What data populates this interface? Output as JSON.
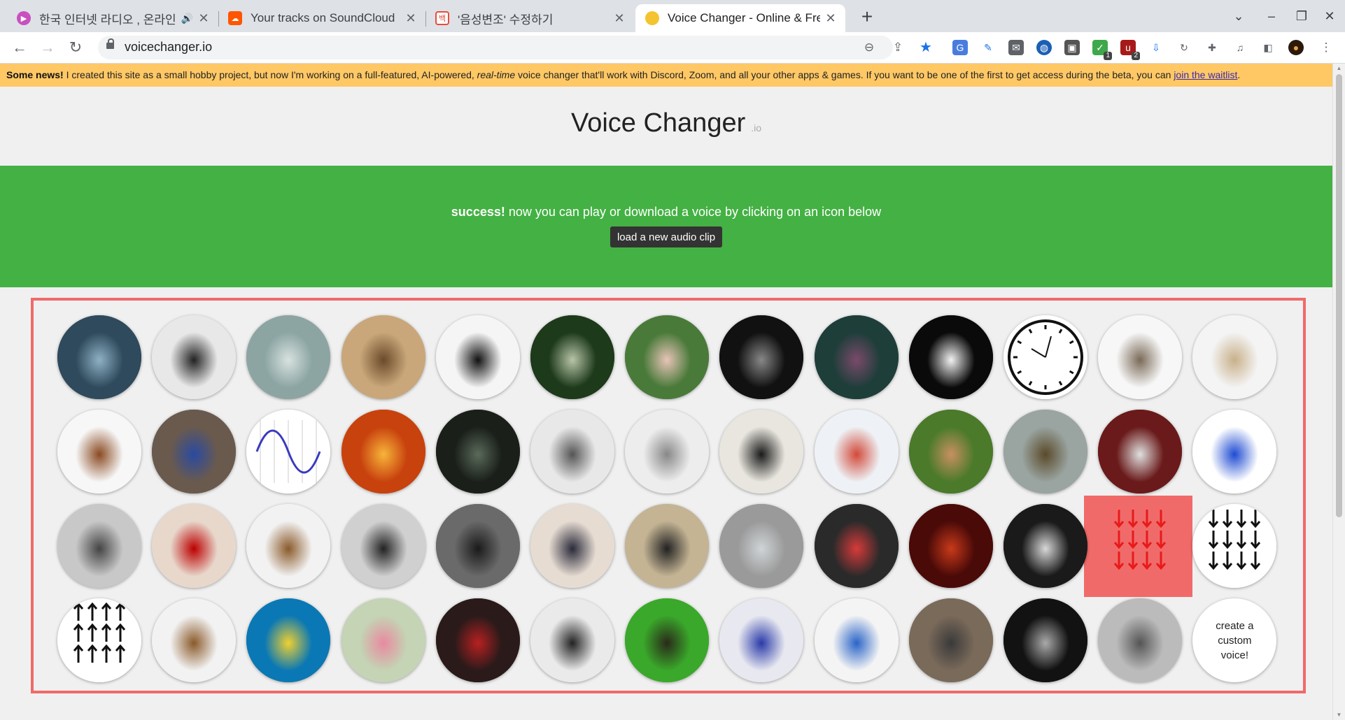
{
  "browser": {
    "tabs": [
      {
        "title": "한국 인터넷 라디오 , 온라인 라디오",
        "favicon": "#c850c0",
        "audio": true
      },
      {
        "title": "Your tracks on SoundCloud",
        "favicon": "#ff5500"
      },
      {
        "title": "'음성변조' 수정하기",
        "favicon": "#e74c3c",
        "favicon_text": "백"
      },
      {
        "title": "Voice Changer - Online & Free",
        "favicon": "#f4c430"
      }
    ],
    "url": "voicechanger.io",
    "extension_badges": [
      "1",
      "2"
    ]
  },
  "page": {
    "news_bold": "Some news!",
    "news_text_1": " I created this site as a small hobby project, but now I'm working on a full-featured, AI-powered, ",
    "news_italic": "real-time",
    "news_text_2": " voice changer that'll work with Discord, Zoom, and all your other apps & games. If you want to be one of the first to get access during the beta, you can ",
    "news_link": "join the waitlist",
    "news_end": ".",
    "title": "Voice Changer",
    "title_suffix": ".io",
    "success_bold": "success!",
    "success_text": " now you can play or download a voice by clicking on an icon below",
    "load_button": "load a new audio clip",
    "custom_voice": "create a custom voice!"
  },
  "voices": [
    {
      "icon": "cave-monster-icon",
      "bg": "#2e4a5c",
      "fg": "#8fb0c4"
    },
    {
      "icon": "old-radio-tower-icon",
      "bg": "#e8e8e8",
      "fg": "#222"
    },
    {
      "icon": "ghost-hand-icon",
      "bg": "#8ca5a3",
      "fg": "#d8e2e0"
    },
    {
      "icon": "cathedral-icon",
      "bg": "#c9a77a",
      "fg": "#6a4a2a"
    },
    {
      "icon": "rotary-telephone-icon",
      "bg": "#f5f5f5",
      "fg": "#111"
    },
    {
      "icon": "alien-icon",
      "bg": "#1d3a1a",
      "fg": "#b8c4a8"
    },
    {
      "icon": "melting-clock-icon",
      "bg": "#4a7a3a",
      "fg": "#e8c4b8"
    },
    {
      "icon": "grey-alien-icon",
      "bg": "#111",
      "fg": "#888"
    },
    {
      "icon": "armored-robot-icon",
      "bg": "#1e3e3a",
      "fg": "#7a4a6a"
    },
    {
      "icon": "anonymous-mask-icon",
      "bg": "#0a0a0a",
      "fg": "#f2f2f2"
    },
    {
      "icon": "reversed-clock-icon",
      "bg": "#ffffff",
      "fg": "#111"
    },
    {
      "icon": "transistor-radio-icon",
      "bg": "#f7f7f7",
      "fg": "#7a6a58"
    },
    {
      "icon": "cymbal-icon",
      "bg": "#f4f4f4",
      "fg": "#c8b08a"
    },
    {
      "icon": "dalek-icon",
      "bg": "#f7f7f7",
      "fg": "#8a4a22"
    },
    {
      "icon": "effects-pedal-icon",
      "bg": "#6a5a4e",
      "fg": "#2a4aa0"
    },
    {
      "icon": "sine-wave-icon",
      "bg": "#ffffff",
      "fg": "#3a3abf"
    },
    {
      "icon": "fire-demon-icon",
      "bg": "#c8420e",
      "fg": "#f7b53a"
    },
    {
      "icon": "dark-cave-icon",
      "bg": "#1a1f1a",
      "fg": "#5a6a5a"
    },
    {
      "icon": "white-robot-icon",
      "bg": "#e8e8e8",
      "fg": "#555"
    },
    {
      "icon": "silver-robot-icon",
      "bg": "#ededed",
      "fg": "#888"
    },
    {
      "icon": "toy-robot-icon",
      "bg": "#e8e6de",
      "fg": "#1a1a1a"
    },
    {
      "icon": "lego-robot-icon",
      "bg": "#eef2f6",
      "fg": "#d24a3a"
    },
    {
      "icon": "snail-icon",
      "bg": "#4a7a2a",
      "fg": "#c89060"
    },
    {
      "icon": "tortoise-icon",
      "bg": "#9aa4a0",
      "fg": "#5a4a2a"
    },
    {
      "icon": "sprinter-icon",
      "bg": "#6a1a1a",
      "fg": "#e0e0e0"
    },
    {
      "icon": "sonic-icon",
      "bg": "#ffffff",
      "fg": "#1e4bd2"
    },
    {
      "icon": "soldier-radio-icon",
      "bg": "#c8c8c8",
      "fg": "#444"
    },
    {
      "icon": "playing-cards-icon",
      "bg": "#e8d8cc",
      "fg": "#b00"
    },
    {
      "icon": "wooden-radio-icon",
      "bg": "#f2f2f2",
      "fg": "#8a5a2a"
    },
    {
      "icon": "gramophone-man-icon",
      "bg": "#d0d0d0",
      "fg": "#222"
    },
    {
      "icon": "dark-knight-icon",
      "bg": "#6a6a6a",
      "fg": "#1a1a1a"
    },
    {
      "icon": "officer-icon",
      "bg": "#e6dcd2",
      "fg": "#2a2a3a"
    },
    {
      "icon": "wtf-meme-icon",
      "bg": "#c4b494",
      "fg": "#222"
    },
    {
      "icon": "cartoon-robot-icon",
      "bg": "#9a9a9a",
      "fg": "#d0d4d6"
    },
    {
      "icon": "kiro-robot-icon",
      "bg": "#2a2a2a",
      "fg": "#d83a3a"
    },
    {
      "icon": "red-demon-icon",
      "bg": "#4a0a08",
      "fg": "#c83a1a"
    },
    {
      "icon": "astronaut-icon",
      "bg": "#1a1a1a",
      "fg": "#d8d8d8"
    },
    {
      "icon": "down-arrows-icon",
      "bg": "#f16a6a",
      "fg": "#e81a1a",
      "hovered": true
    },
    {
      "icon": "down-arrows-icon",
      "bg": "#ffffff",
      "fg": "#111"
    },
    {
      "icon": "up-arrows-icon",
      "bg": "#ffffff",
      "fg": "#111"
    },
    {
      "icon": "chipmunk-icon",
      "bg": "#f2f2f2",
      "fg": "#8a5a2a"
    },
    {
      "icon": "scuba-diver-icon",
      "bg": "#0a78b4",
      "fg": "#f0d030"
    },
    {
      "icon": "cute-tv-icon",
      "bg": "#c4d4b4",
      "fg": "#e88aa0"
    },
    {
      "icon": "red-car-icon",
      "bg": "#2a1a1a",
      "fg": "#b82020"
    },
    {
      "icon": "phone-cord-icon",
      "bg": "#eaeaea",
      "fg": "#222"
    },
    {
      "icon": "mosquito-icon",
      "bg": "#3aa82a",
      "fg": "#2a2a1a"
    },
    {
      "icon": "transformer-icon",
      "bg": "#e8e8f0",
      "fg": "#2a3aa8"
    },
    {
      "icon": "megaphone-icon",
      "bg": "#f4f4f4",
      "fg": "#2a64c8"
    },
    {
      "icon": "bane-mask-icon",
      "bg": "#7a6a5a",
      "fg": "#3a3a3a"
    },
    {
      "icon": "bike-brake-icon",
      "bg": "#121212",
      "fg": "#aaa"
    },
    {
      "icon": "metal-knob-icon",
      "bg": "#bbb",
      "fg": "#555"
    }
  ]
}
